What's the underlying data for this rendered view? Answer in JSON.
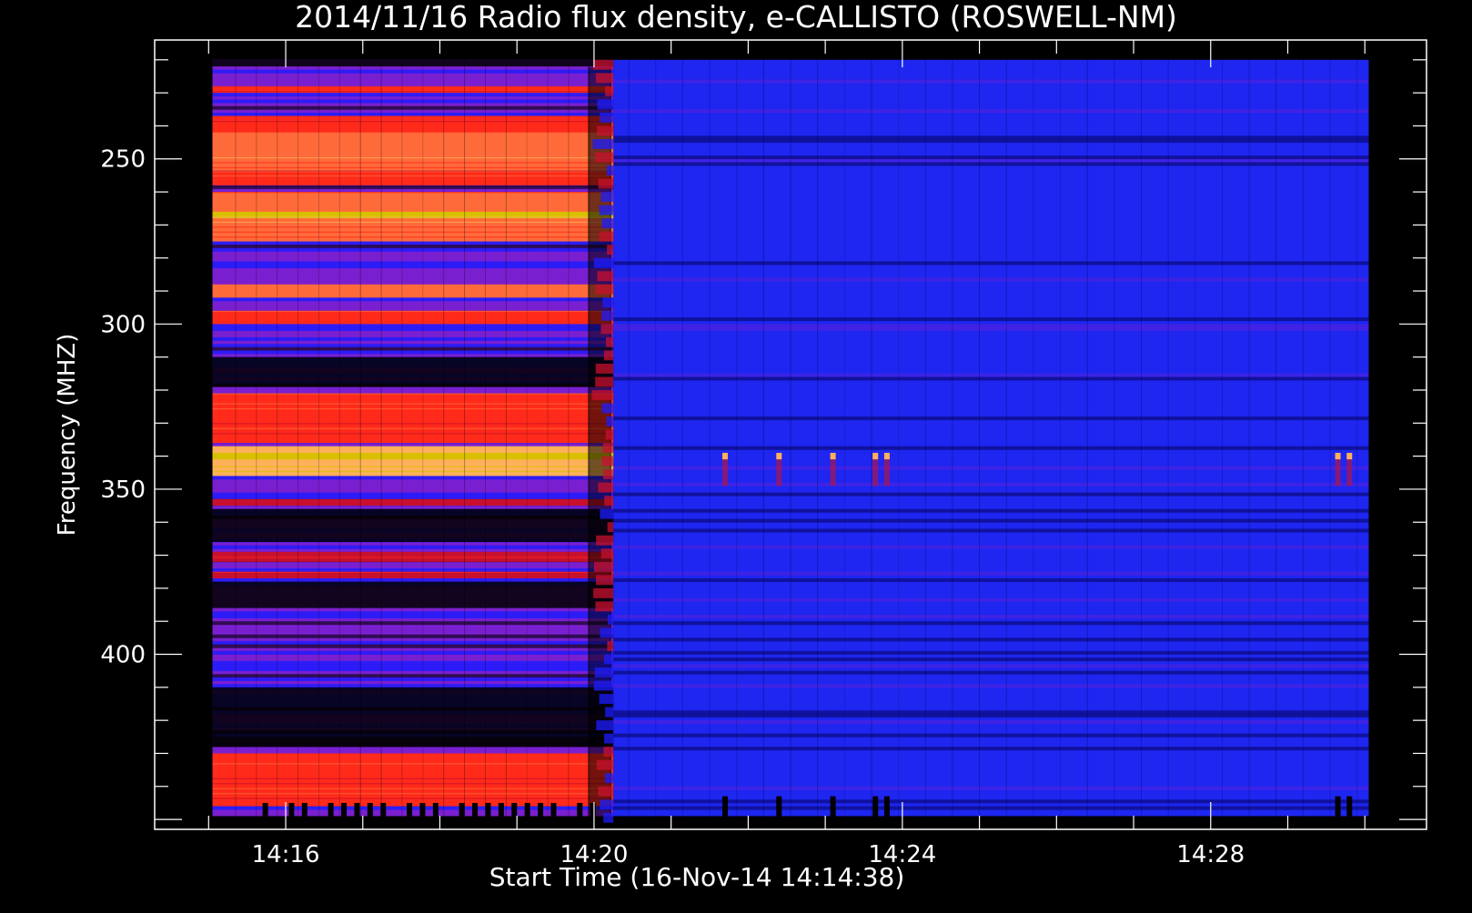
{
  "chart_data": {
    "type": "heatmap",
    "title": "2014/11/16  Radio flux density, e-CALLISTO (ROSWELL-NM)",
    "xlabel": "Start Time (16-Nov-14 14:14:38)",
    "ylabel": "Frequency (MHZ)",
    "x_ticks": [
      {
        "label": "14:16",
        "minutes": 16
      },
      {
        "label": "14:20",
        "minutes": 20
      },
      {
        "label": "14:24",
        "minutes": 24
      },
      {
        "label": "14:28",
        "minutes": 28
      }
    ],
    "y_ticks": [
      {
        "label": "250",
        "value": 250
      },
      {
        "label": "300",
        "value": 300
      },
      {
        "label": "350",
        "value": 350
      },
      {
        "label": "400",
        "value": 400
      }
    ],
    "xlim_minutes": [
      14.3,
      30.8
    ],
    "ylim_mhz": [
      214,
      453
    ],
    "y_inverted": true,
    "data_extent": {
      "start_minutes": 15.05,
      "end_minutes": 30.05,
      "min_mhz": 220,
      "max_mhz": 449
    },
    "colormap": [
      "#000000",
      "#1c1cff",
      "#7a1fd0",
      "#c8102e",
      "#ff2a1a",
      "#ff6a3a",
      "#ffb15a",
      "#d8c000"
    ],
    "background_color": "#1e26f0",
    "transition_minutes": 20.25,
    "hot_bands_before_transition": [
      {
        "from_mhz": 228,
        "to_mhz": 230,
        "level": 4
      },
      {
        "from_mhz": 237,
        "to_mhz": 258,
        "level": 4
      },
      {
        "from_mhz": 242,
        "to_mhz": 254,
        "level": 5
      },
      {
        "from_mhz": 260,
        "to_mhz": 275,
        "level": 5
      },
      {
        "from_mhz": 266,
        "to_mhz": 268,
        "level": 7
      },
      {
        "from_mhz": 288,
        "to_mhz": 292,
        "level": 5
      },
      {
        "from_mhz": 296,
        "to_mhz": 300,
        "level": 4
      },
      {
        "from_mhz": 321,
        "to_mhz": 336,
        "level": 4
      },
      {
        "from_mhz": 337,
        "to_mhz": 346,
        "level": 6
      },
      {
        "from_mhz": 339,
        "to_mhz": 341,
        "level": 7
      },
      {
        "from_mhz": 353,
        "to_mhz": 355,
        "level": 3
      },
      {
        "from_mhz": 369,
        "to_mhz": 372,
        "level": 3
      },
      {
        "from_mhz": 375,
        "to_mhz": 377,
        "level": 3
      },
      {
        "from_mhz": 430,
        "to_mhz": 446,
        "level": 4
      }
    ],
    "dark_bands_before_transition": [
      {
        "from_mhz": 220,
        "to_mhz": 222
      },
      {
        "from_mhz": 310,
        "to_mhz": 319
      },
      {
        "from_mhz": 356,
        "to_mhz": 366
      },
      {
        "from_mhz": 378,
        "to_mhz": 386
      },
      {
        "from_mhz": 410,
        "to_mhz": 428
      }
    ],
    "spike_minutes": [
      21.7,
      22.4,
      23.1,
      23.65,
      23.8,
      29.65,
      29.8
    ],
    "spike_freq_mhz": 340
  }
}
